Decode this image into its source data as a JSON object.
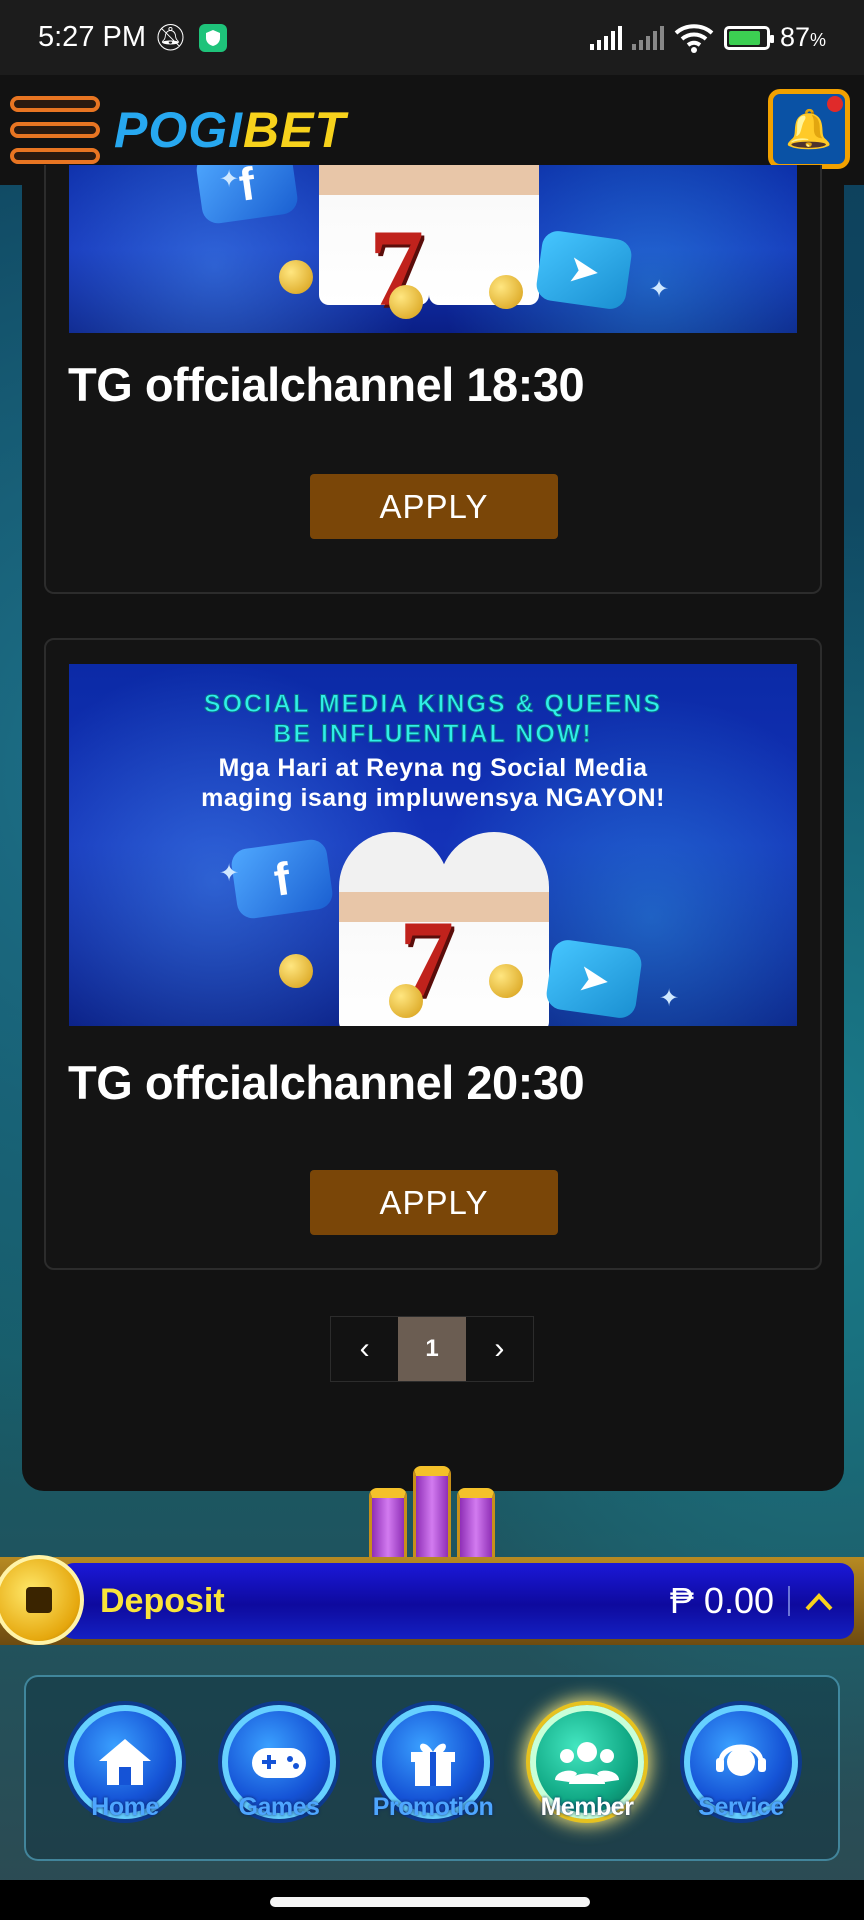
{
  "status_bar": {
    "time": "5:27 PM",
    "battery": "87",
    "battery_unit": "%",
    "battery_level": 0.87
  },
  "header": {
    "logo_part1": "POGI",
    "logo_part2": "BET",
    "menu_icon": "hamburger-icon",
    "notification_icon": "bell-icon"
  },
  "promotions": [
    {
      "title": "TG offcialchannel 18:30",
      "button": "APPLY"
    },
    {
      "title": "TG offcialchannel 20:30",
      "button": "APPLY",
      "banner_lines": [
        "SOCIAL MEDIA KINGS & QUEENS",
        "BE INFLUENTIAL NOW!",
        "Mga Hari at Reyna ng Social Media",
        "maging isang impluwensya NGAYON!"
      ]
    }
  ],
  "pagination": {
    "prev": "‹",
    "current": "1",
    "next": "›"
  },
  "deposit": {
    "label": "Deposit",
    "amount": "₱ 0.00",
    "chevron": "^"
  },
  "nav": [
    {
      "label": "Home",
      "icon": "home-icon",
      "glyph": "⌂",
      "active": false
    },
    {
      "label": "Games",
      "icon": "gamepad-icon",
      "glyph": "🎮",
      "active": false
    },
    {
      "label": "Promotion",
      "icon": "gift-icon",
      "glyph": "🎁",
      "active": false
    },
    {
      "label": "Member",
      "icon": "users-icon",
      "glyph": "👥",
      "active": true
    },
    {
      "label": "Service",
      "icon": "headset-icon",
      "glyph": "🎧",
      "active": false
    }
  ],
  "colors": {
    "accent_orange": "#e87522",
    "apply_button": "#7a4608",
    "deposit_label": "#f9e43a",
    "nav_label": "#4ea6ff"
  }
}
